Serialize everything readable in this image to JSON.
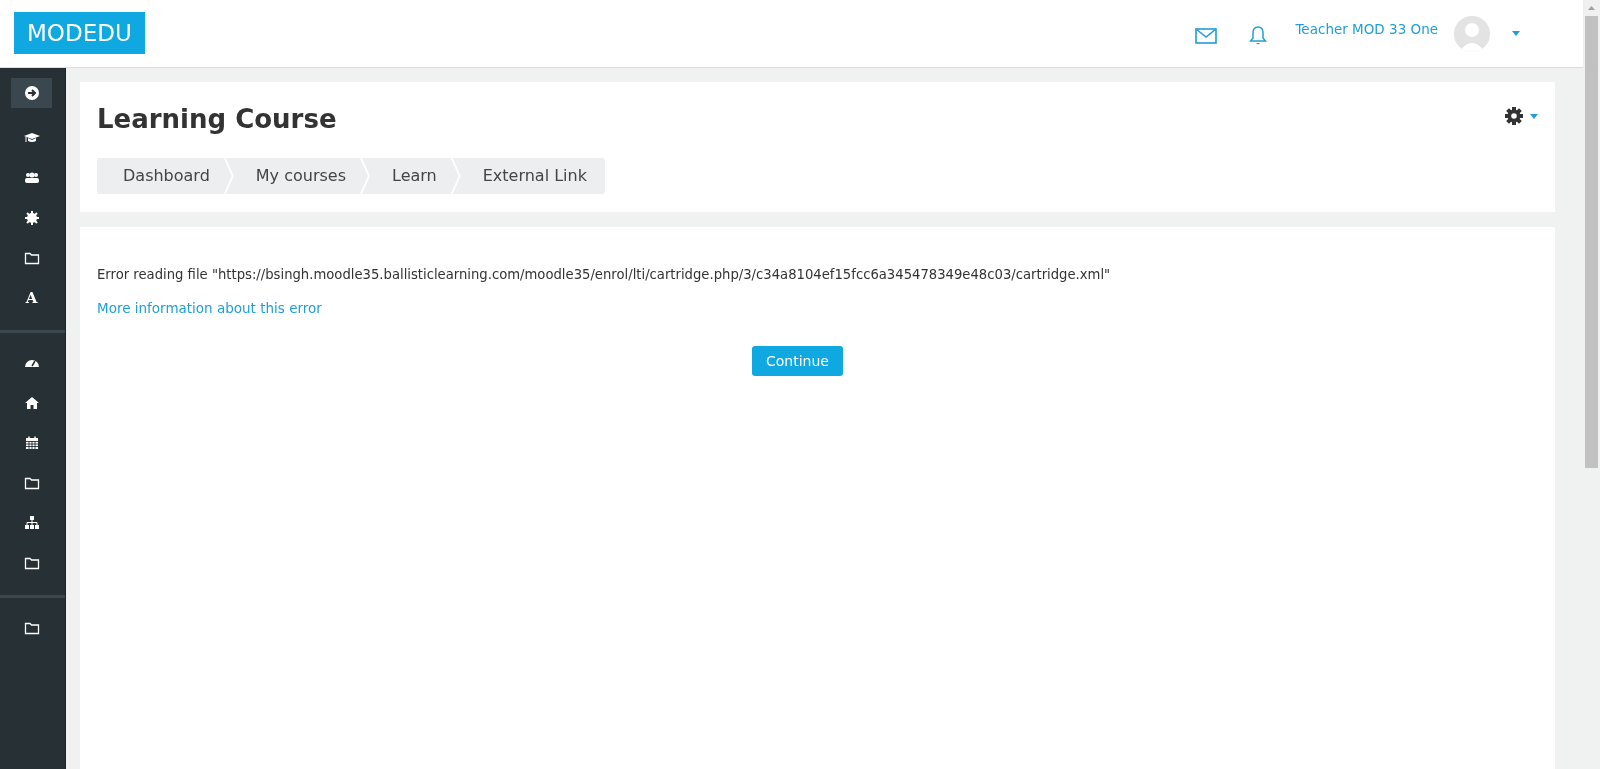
{
  "navbar": {
    "logo": "MODEDU",
    "user_name": "Teacher MOD 33 One"
  },
  "sidebar": {
    "sections": [
      {
        "items": [
          {
            "kind": "arrow",
            "selected": true
          },
          {
            "kind": "cap",
            "selected": false
          },
          {
            "kind": "users",
            "selected": false
          },
          {
            "kind": "gear",
            "selected": false
          },
          {
            "kind": "folder",
            "selected": false
          },
          {
            "kind": "glyph",
            "glyph": "A",
            "selected": false
          }
        ]
      },
      {
        "items": [
          {
            "kind": "gauge",
            "selected": false
          },
          {
            "kind": "home",
            "selected": false
          },
          {
            "kind": "calendar",
            "selected": false
          },
          {
            "kind": "folder",
            "selected": false
          },
          {
            "kind": "sitemap",
            "selected": false
          },
          {
            "kind": "folder",
            "selected": false
          }
        ]
      },
      {
        "items": [
          {
            "kind": "folder",
            "selected": false
          }
        ]
      }
    ]
  },
  "page_header": {
    "title": "Learning Course",
    "breadcrumb": [
      "Dashboard",
      "My courses",
      "Learn",
      "External Link"
    ]
  },
  "error": {
    "message": "Error reading file \"https://bsingh.moodle35.ballisticlearning.com/moodle35/enrol/lti/cartridge.php/3/c34a8104ef15fcc6a345478349e48c03/cartridge.xml\"",
    "more_info_link": "More information about this error",
    "button": "Continue"
  }
}
